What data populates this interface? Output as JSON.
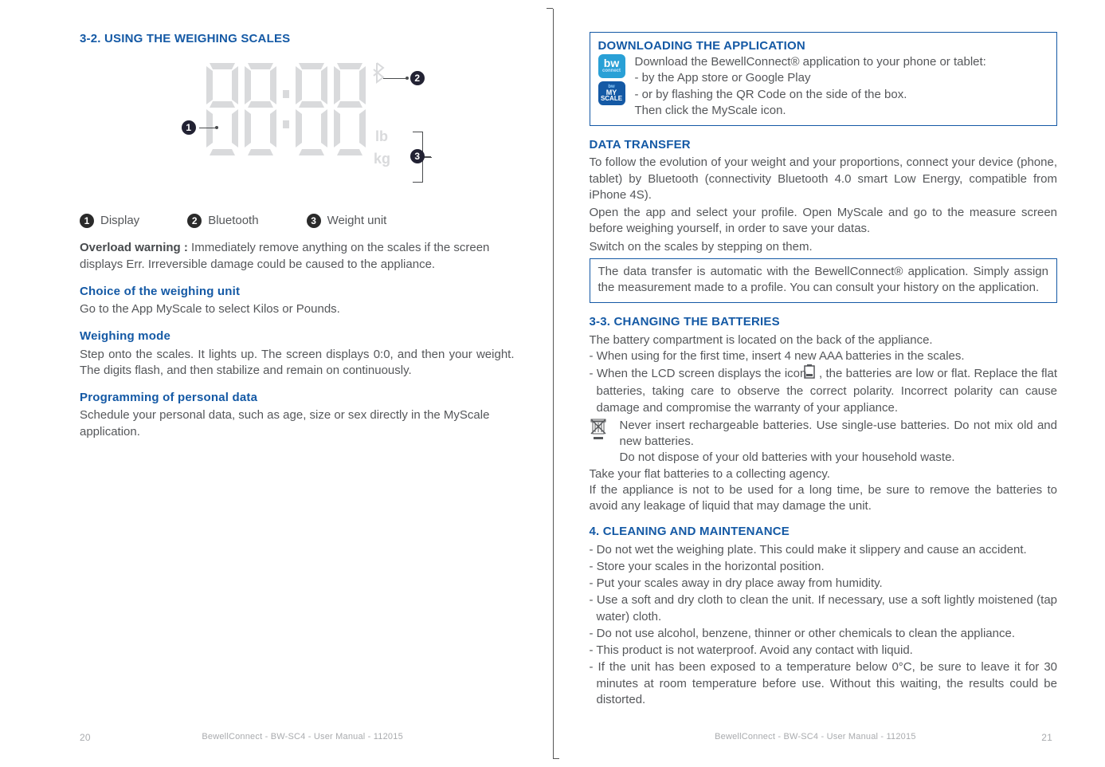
{
  "leftPage": {
    "s32_heading": "3-2. USING THE WEIGHING SCALES",
    "display_lcd": {
      "unit_lb": "lb",
      "unit_kg": "kg"
    },
    "legend": {
      "n1": "1",
      "l1": "Display",
      "n2": "2",
      "l2": "Bluetooth",
      "n3": "3",
      "l3": "Weight unit"
    },
    "overload_bold": "Overload warning : ",
    "overload_text": "Immediately remove anything on the scales if the screen displays Err. Irreversible damage could be caused to the appliance.",
    "choice_heading": "Choice of the weighing unit",
    "choice_text": "Go to the App MyScale to select Kilos or Pounds.",
    "weigh_heading": "Weighing mode",
    "weigh_text": "Step onto the scales. It lights up. The screen displays 0:0, and then your weight. The digits flash, and then stabilize and remain on continuously.",
    "prog_heading": "Programming of personal data",
    "prog_text": "Schedule your personal data, such as age, size or sex directly in the MyScale application.",
    "footer_center": "BewellConnect - BW-SC4 - User Manual - 112015",
    "pagenum": "20"
  },
  "rightPage": {
    "box1": {
      "heading": "DOWNLOADING THE APPLICATION",
      "line1": "Download the BewellConnect® application to your phone or tablet:",
      "line2": "- by the App store or Google Play",
      "line3": "- or by flashing the QR Code on the side of the box.",
      "line4": "Then click the MyScale icon.",
      "icon_bw_label": "bw",
      "icon_bw_sub": "connect",
      "icon_ms_top": "bw",
      "icon_ms_mid": "MY",
      "icon_ms_bot": "SCALE"
    },
    "data_heading": "DATA TRANSFER",
    "data_p1": "To follow the evolution of your weight and your proportions, connect your device (phone, tablet) by Bluetooth (connectivity Bluetooth 4.0 smart Low Energy, compatible from iPhone 4S).",
    "data_p2": "Open the app and select your profile. Open MyScale and go to the measure screen before weighing yourself, in order to save your datas.",
    "data_p3": "Switch on the scales by stepping on them.",
    "box2_p": "The data transfer is automatic with the BewellConnect® application. Simply assign the measurement made to a profile. You can consult your history on the application.",
    "s33_heading": "3-3. CHANGING THE BATTERIES",
    "s33_p1": "The battery compartment is located on the back of the appliance.",
    "s33_b1": "- When using for the first time, insert 4 new AAA batteries in the scales.",
    "s33_b2a": "- When the LCD screen displays the icon ",
    "s33_b2b": " , the batteries are low or flat. Replace the flat batteries, taking care to observe the correct polarity. Incorrect polarity can cause damage and compromise the warranty of your appliance.",
    "s33_warn1": "Never insert rechargeable batteries. Use single-use batteries. Do not mix old and new batteries.",
    "s33_warn2": "Do not dispose of your old batteries with your household waste.",
    "s33_p2": "Take your flat batteries to a collecting agency.",
    "s33_p3": "If the appliance is not to be used for a long time, be sure to remove the batteries to avoid any leakage of liquid that may damage the unit.",
    "s4_heading": "4. CLEANING AND MAINTENANCE",
    "s4_items": {
      "i1": "- Do not wet the weighing plate. This could make it slippery and cause an accident.",
      "i2": "- Store your scales in the horizontal position.",
      "i3": "- Put your scales away in dry place away from humidity.",
      "i4": "- Use a soft and dry cloth to clean the unit. If necessary, use a soft lightly moistened (tap water) cloth.",
      "i5": "- Do not use alcohol, benzene, thinner or other chemicals to clean the appliance.",
      "i6": "- This product is not waterproof. Avoid any contact with liquid.",
      "i7": "- If the unit has been exposed to a temperature below 0°C, be sure to leave it for 30 minutes at room temperature before use. Without this waiting, the results could be distorted."
    },
    "footer_center": "BewellConnect - BW-SC4 - User Manual - 112015",
    "pagenum": "21"
  }
}
